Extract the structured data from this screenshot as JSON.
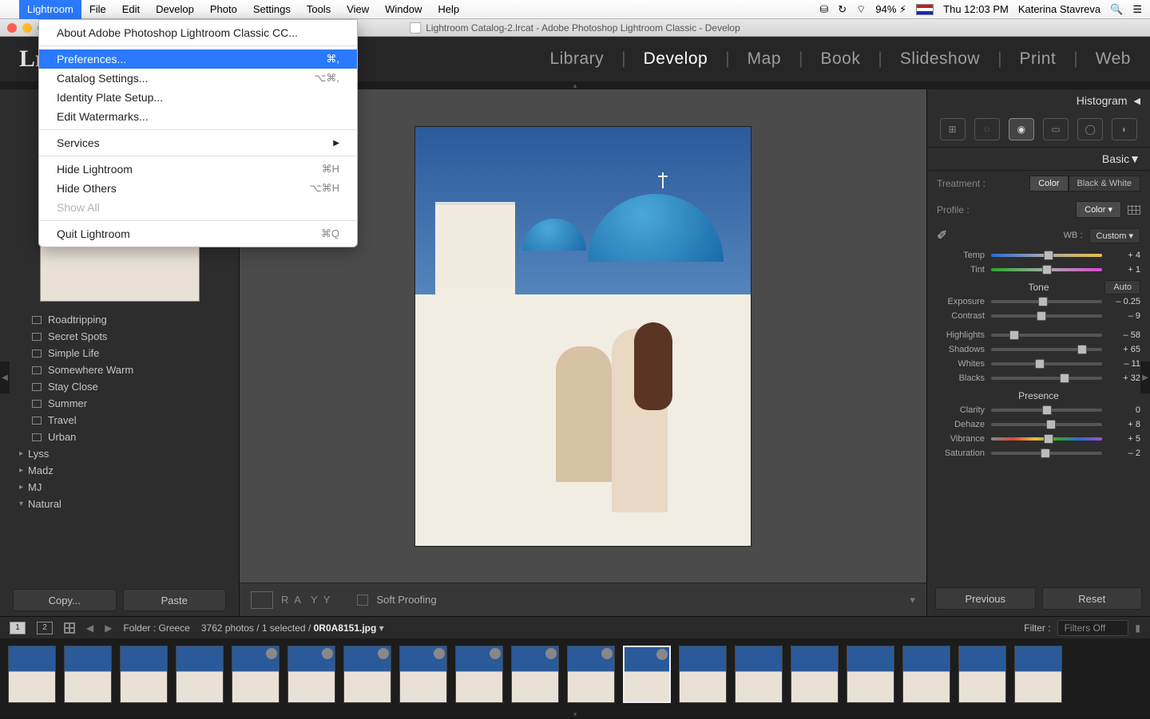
{
  "menubar": {
    "app": "Lightroom",
    "items": [
      "File",
      "Edit",
      "Develop",
      "Photo",
      "Settings",
      "Tools",
      "View",
      "Window",
      "Help"
    ],
    "status": {
      "battery": "94%",
      "clock": "Thu 12:03 PM",
      "user": "Katerina Stavreva"
    }
  },
  "window": {
    "title": "Lightroom Catalog-2.lrcat - Adobe Photoshop Lightroom Classic - Develop"
  },
  "dropdown": {
    "about": "About Adobe Photoshop Lightroom Classic CC...",
    "prefs": "Preferences...",
    "prefs_key": "⌘,",
    "catalog": "Catalog Settings...",
    "catalog_key": "⌥⌘,",
    "identity": "Identity Plate Setup...",
    "watermarks": "Edit Watermarks...",
    "services": "Services",
    "hide": "Hide Lightroom",
    "hide_key": "⌘H",
    "hideothers": "Hide Others",
    "hideothers_key": "⌥⌘H",
    "showall": "Show All",
    "quit": "Quit Lightroom",
    "quit_key": "⌘Q"
  },
  "modules": {
    "logo": "Lr",
    "items": [
      "Library",
      "Develop",
      "Map",
      "Book",
      "Slideshow",
      "Print",
      "Web"
    ],
    "active": "Develop"
  },
  "left": {
    "presets": [
      "Roadtripping",
      "Secret Spots",
      "Simple Life",
      "Somewhere Warm",
      "Stay Close",
      "Summer",
      "Travel",
      "Urban"
    ],
    "folders": [
      "Lyss",
      "Madz",
      "MJ",
      "Natural"
    ],
    "copy_btn": "Copy...",
    "paste_btn": "Paste"
  },
  "toolbar": {
    "soft_proof": "Soft Proofing"
  },
  "right": {
    "histogram": "Histogram",
    "basic": "Basic",
    "treatment_label": "Treatment :",
    "color": "Color",
    "bw": "Black & White",
    "profile_label": "Profile :",
    "profile_value": "Color",
    "wb_label": "WB :",
    "wb_value": "Custom",
    "temp": {
      "label": "Temp",
      "value": "+ 4",
      "pos": 52
    },
    "tint": {
      "label": "Tint",
      "value": "+ 1",
      "pos": 50
    },
    "tone": "Tone",
    "auto": "Auto",
    "exposure": {
      "label": "Exposure",
      "value": "– 0.25",
      "pos": 47
    },
    "contrast": {
      "label": "Contrast",
      "value": "– 9",
      "pos": 45
    },
    "highlights": {
      "label": "Highlights",
      "value": "– 58",
      "pos": 21
    },
    "shadows": {
      "label": "Shadows",
      "value": "+ 65",
      "pos": 82
    },
    "whites": {
      "label": "Whites",
      "value": "– 11",
      "pos": 44
    },
    "blacks": {
      "label": "Blacks",
      "value": "+ 32",
      "pos": 66
    },
    "presence": "Presence",
    "clarity": {
      "label": "Clarity",
      "value": "0",
      "pos": 50
    },
    "dehaze": {
      "label": "Dehaze",
      "value": "+ 8",
      "pos": 54
    },
    "vibrance": {
      "label": "Vibrance",
      "value": "+ 5",
      "pos": 52
    },
    "saturation": {
      "label": "Saturation",
      "value": "– 2",
      "pos": 49
    },
    "previous_btn": "Previous",
    "reset_btn": "Reset"
  },
  "infobar": {
    "folder": "Folder : Greece",
    "count": "3762 photos / 1 selected /",
    "file": "0R0A8151.jpg",
    "filter_label": "Filter :",
    "filter_value": "Filters Off"
  }
}
